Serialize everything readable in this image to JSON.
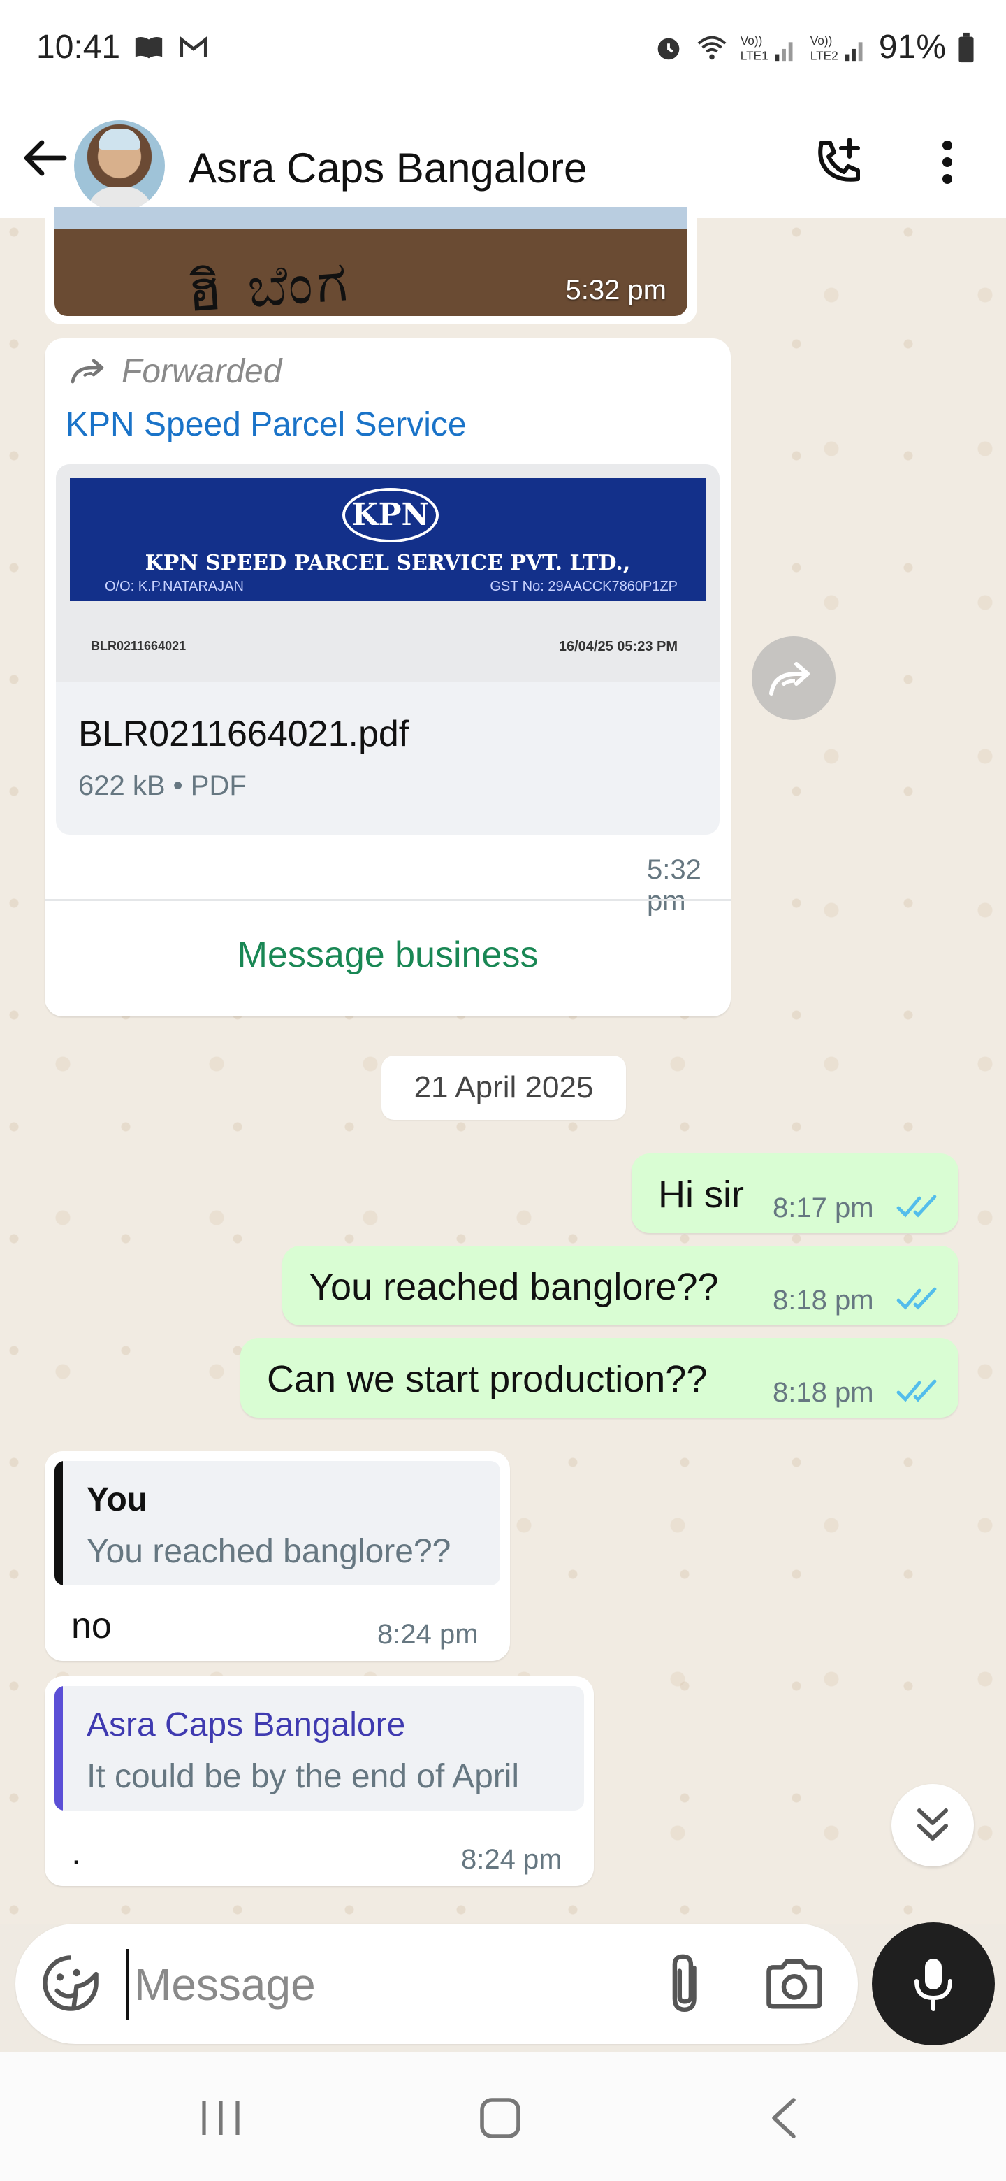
{
  "status_bar": {
    "time": "10:41",
    "battery": "91%",
    "signal_labels": [
      "Vo)) LTE1",
      "Vo)) LTE2"
    ]
  },
  "header": {
    "title": "Asra Caps Bangalore"
  },
  "messages": {
    "image_time": "5:32 pm",
    "forwarded": {
      "label": "Forwarded",
      "sender": "KPN Speed Parcel Service",
      "document": {
        "logo_text": "KPN",
        "company": "KPN SPEED PARCEL SERVICE PVT. LTD.,",
        "owner": "O/O: K.P.NATARAJAN",
        "gst": "GST No: 29AACCK7860P1ZP",
        "lr_number": "BLR0211664021",
        "date": "16/04/25 05:23 PM",
        "filename": "BLR0211664021.pdf",
        "meta": "622 kB • PDF"
      },
      "time": "5:32 pm",
      "action": "Message business"
    },
    "date_separator": "21 April 2025",
    "outgoing": [
      {
        "text": "Hi sir",
        "time": "8:17 pm"
      },
      {
        "text": "You reached banglore??",
        "time": "8:18 pm"
      },
      {
        "text": "Can we start production??",
        "time": "8:18 pm"
      }
    ],
    "incoming": [
      {
        "quote_author": "You",
        "quote_text": "You reached banglore??",
        "text": "no",
        "time": "8:24 pm",
        "quote_color": "#111111"
      },
      {
        "quote_author": "Asra Caps Bangalore",
        "quote_text": "It could be by the end of April",
        "text": ".",
        "time": "8:24 pm",
        "quote_color": "#5b4fd6"
      }
    ]
  },
  "composer": {
    "placeholder": "Message"
  },
  "colors": {
    "outgoing_bubble": "#d9fdd3",
    "read_ticks": "#53bdeb",
    "sender_blue": "#1a73c8",
    "action_green": "#198754"
  }
}
